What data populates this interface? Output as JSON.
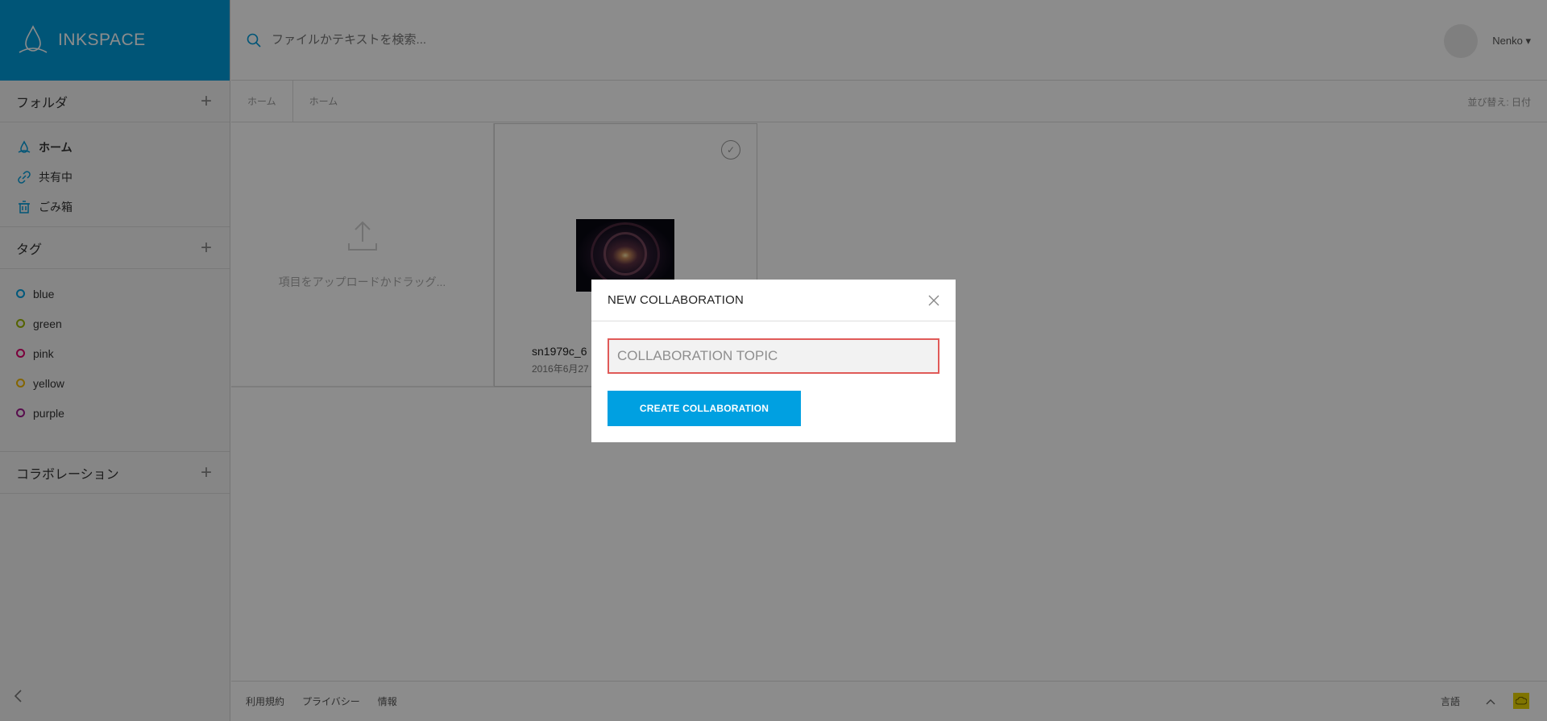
{
  "app": {
    "logo_text": "INKSPACE"
  },
  "search": {
    "placeholder": "ファイルかテキストを検索..."
  },
  "user": {
    "name": "Nenko ▾"
  },
  "sidebar": {
    "folders_title": "フォルダ",
    "nav_items": [
      {
        "label": "ホーム",
        "icon": "droplet-icon"
      },
      {
        "label": "共有中",
        "icon": "link-icon"
      },
      {
        "label": "ごみ箱",
        "icon": "trash-icon"
      }
    ],
    "tags_title": "タグ",
    "tags": [
      {
        "label": "blue",
        "color": "#00a0e1"
      },
      {
        "label": "green",
        "color": "#9bb500"
      },
      {
        "label": "pink",
        "color": "#e0006e"
      },
      {
        "label": "yellow",
        "color": "#f0b800"
      },
      {
        "label": "purple",
        "color": "#a0188c"
      }
    ],
    "collab_title": "コラボレーション",
    "add_symbol": "+"
  },
  "breadcrumb": {
    "crumb1": "ホーム",
    "crumb2": "ホーム",
    "sort_label": "並び替え: 日付"
  },
  "content": {
    "upload_text": "項目をアップロードかドラッグ...",
    "file": {
      "name": "sn1979c_6",
      "date": "2016年6月27"
    }
  },
  "footer": {
    "terms": "利用規約",
    "privacy": "プライバシー",
    "info": "情報",
    "language": "言語"
  },
  "modal": {
    "title": "NEW COLLABORATION",
    "input_placeholder": "COLLABORATION TOPIC",
    "create_label": "CREATE COLLABORATION"
  },
  "colors": {
    "brand": "#009bd9",
    "button": "#00a0e1",
    "input_border": "#e05a58",
    "cloud_badge": "#e8d400"
  }
}
